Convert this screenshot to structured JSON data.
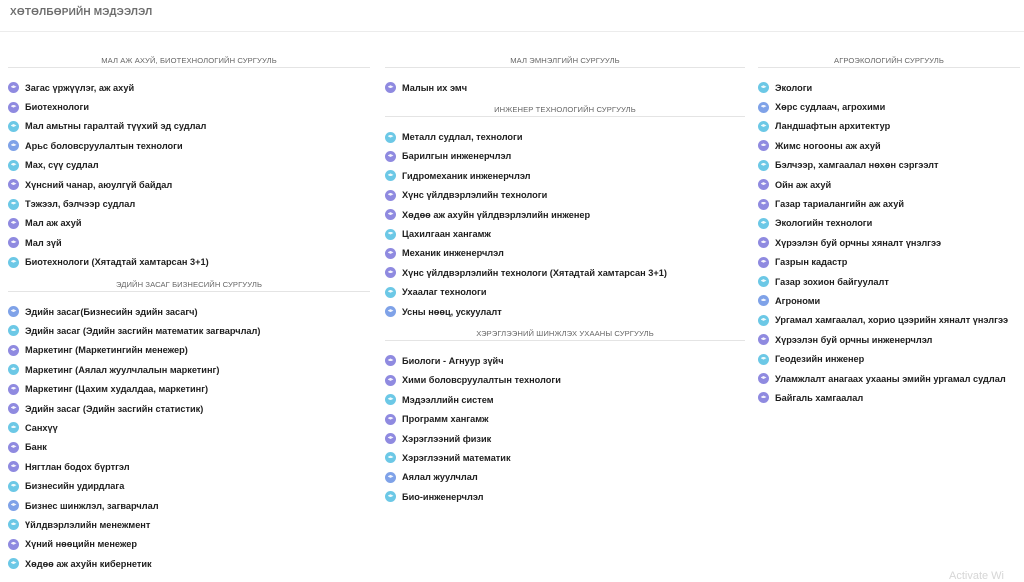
{
  "page": {
    "title": "ХӨТӨЛБӨРИЙН МЭДЭЭЛЭЛ",
    "watermark": "Activate Wi"
  },
  "colors": {
    "icon_purple": "#8f8ae0",
    "icon_cyan": "#6cc8e6",
    "icon_blue": "#7fa2e8"
  },
  "columns": [
    {
      "sections": [
        {
          "heading": "МАЛ АЖ АХУЙ, БИОТЕХНОЛОГИЙН СУРГУУЛЬ",
          "items": [
            "Загас үржүүлэг, аж ахуй",
            "Биотехнологи",
            "Мал амьтны гаралтай түүхий эд судлал",
            "Арьс боловсруулалтын технологи",
            "Мах, сүү судлал",
            "Хүнсний чанар, аюулгүй байдал",
            "Тэжээл, бэлчээр судлал",
            "Мал аж ахуй",
            "Мал зүй",
            "Биотехнологи (Хятадтай хамтарсан 3+1)"
          ]
        },
        {
          "heading": "ЭДИЙН ЗАСАГ БИЗНЕСИЙН СУРГУУЛЬ",
          "items": [
            "Эдийн засаг(Бизнесийн эдийн засагч)",
            "Эдийн засаг (Эдийн засгийн математик загварчлал)",
            "Маркетинг (Маркетингийн менежер)",
            "Маркетинг (Аялал жуулчлалын маркетинг)",
            "Маркетинг (Цахим худалдаа, маркетинг)",
            "Эдийн засаг (Эдийн засгийн статистик)",
            "Санхүү",
            "Банк",
            "Нягтлан бодох бүртгэл",
            "Бизнесийн удирдлага",
            "Бизнес шинжлэл, загварчлал",
            "Үйлдвэрлэлийн менежмент",
            "Хүний нөөцийн менежер",
            "Хөдөө аж ахуйн кибернетик"
          ]
        }
      ]
    },
    {
      "sections": [
        {
          "heading": "МАЛ ЭМНЭЛГИЙН СУРГУУЛЬ",
          "items": [
            "Малын их эмч"
          ]
        },
        {
          "heading": "ИНЖЕНЕР ТЕХНОЛОГИЙН СУРГУУЛЬ",
          "items": [
            "Металл судлал, технологи",
            "Барилгын инженерчлэл",
            "Гидромеханик инженерчлэл",
            "Хүнс үйлдвэрлэлийн технологи",
            "Хөдөө аж ахуйн үйлдвэрлэлийн инженер",
            "Цахилгаан хангамж",
            "Механик инженерчлэл",
            "Хүнс үйлдвэрлэлийн технологи (Хятадтай хамтарсан 3+1)",
            "Ухаалаг технологи",
            "Усны нөөц, ускуулалт"
          ]
        },
        {
          "heading": "ХЭРЭГЛЭЭНИЙ ШИНЖЛЭХ УХААНЫ СУРГУУЛЬ",
          "items": [
            "Биологи - Агнуур зүйч",
            "Хими боловсруулалтын технологи",
            "Мэдээллийн систем",
            "Программ хангамж",
            "Хэрэглээний физик",
            "Хэрэглээний математик",
            "Аялал жуулчлал",
            "Био-инженерчлэл"
          ]
        }
      ]
    },
    {
      "sections": [
        {
          "heading": "АГРОЭКОЛОГИЙН СУРГУУЛЬ",
          "items": [
            "Экологи",
            "Хөрс судлаач, агрохими",
            "Ландшафтын архитектур",
            "Жимс ногооны аж ахуй",
            "Бэлчээр, хамгаалал нөхөн сэргээлт",
            "Ойн аж ахуй",
            "Газар тариалангийн аж ахуй",
            "Экологийн технологи",
            "Хүрээлэн буй орчны хяналт үнэлгээ",
            "Газрын кадастр",
            "Газар зохион байгуулалт",
            "Агрономи",
            "Ургамал хамгаалал, хорио цээрийн хяналт үнэлгээ",
            "Хүрээлэн буй орчны инженерчлэл",
            "Геодезийн инженер",
            "Уламжлалт анагаах ухааны эмийн ургамал судлал",
            "Байгаль хамгаалал"
          ]
        }
      ]
    }
  ]
}
